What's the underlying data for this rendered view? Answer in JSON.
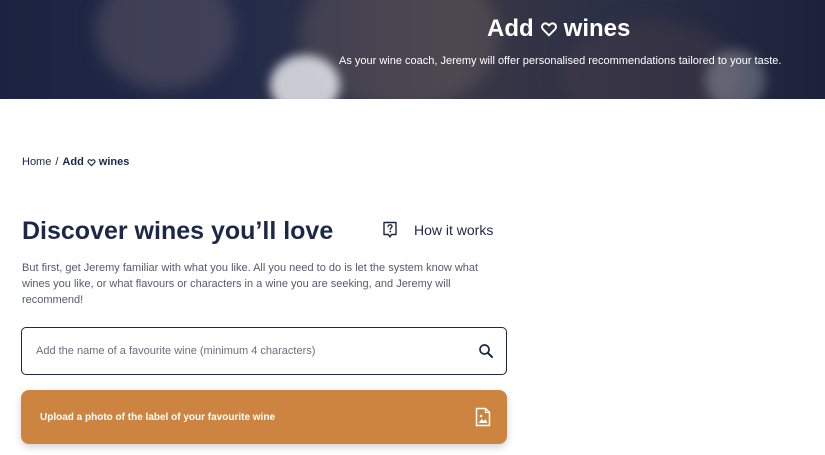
{
  "hero": {
    "title_prefix": "Add",
    "title_suffix": "wines",
    "subtitle": "As your wine coach, Jeremy will offer personalised recommendations tailored to your taste."
  },
  "breadcrumb": {
    "home": "Home",
    "separator": "/",
    "current_prefix": "Add",
    "current_suffix": "wines"
  },
  "main": {
    "title": "Discover wines you’ll love",
    "how_it_works": "How it works",
    "intro": "But first, get Jeremy familiar with what you like. All you need to do is let the system know what wines you like, or what flavours or characters in a wine you are seeking, and Jeremy will recommend!"
  },
  "search": {
    "placeholder": "Add the name of a favourite wine (minimum 4 characters)",
    "value": ""
  },
  "upload": {
    "label": "Upload a photo of the label of your favourite wine"
  },
  "icons": {
    "heart": "heart-icon",
    "help": "help-icon",
    "search": "search-icon",
    "photo": "image-file-icon"
  },
  "colors": {
    "navy": "#1d2746",
    "accent": "#cd8440",
    "white": "#ffffff"
  }
}
